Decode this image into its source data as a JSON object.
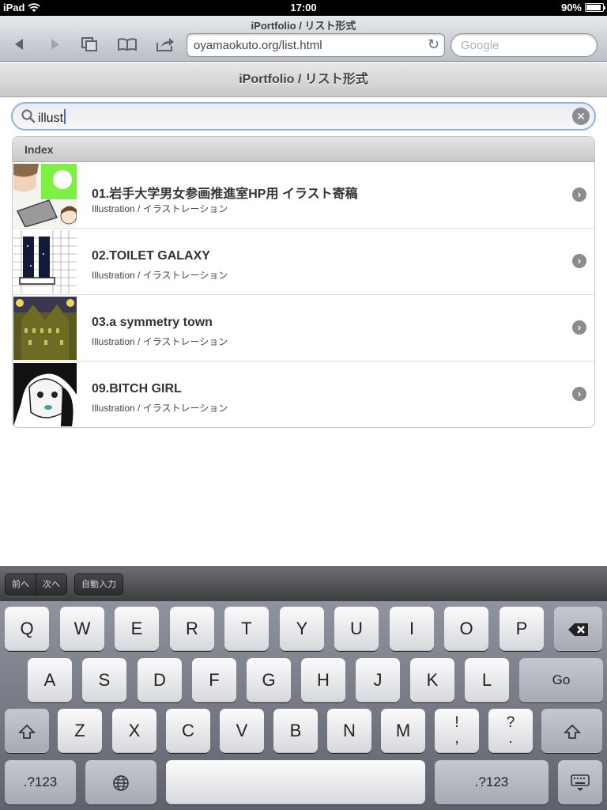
{
  "status": {
    "device": "iPad",
    "time": "17:00",
    "battery": "90%",
    "battery_level": 0.9
  },
  "browser": {
    "page_title": "iPortfolio / リスト形式",
    "url": "oyamaokuto.org/list.html",
    "search_placeholder": "Google"
  },
  "page": {
    "header": "iPortfolio / リスト形式",
    "search_value": "illust",
    "list_header": "Index",
    "items": [
      {
        "title": "01.岩手大学男女参画推進室HP用 イラスト寄稿",
        "subtitle": "Illustration / イラストレーション"
      },
      {
        "title": "02.TOILET GALAXY",
        "subtitle": "Illustration / イラストレーション"
      },
      {
        "title": "03.a symmetry town",
        "subtitle": "Illustration / イラストレーション"
      },
      {
        "title": "09.BITCH GIRL",
        "subtitle": "Illustration / イラストレーション"
      }
    ]
  },
  "accessory": {
    "prev": "前へ",
    "next": "次へ",
    "autofill": "自動入力"
  },
  "keyboard": {
    "row1": [
      "Q",
      "W",
      "E",
      "R",
      "T",
      "Y",
      "U",
      "I",
      "O",
      "P"
    ],
    "row2": [
      "A",
      "S",
      "D",
      "F",
      "G",
      "H",
      "J",
      "K",
      "L"
    ],
    "go": "Go",
    "row3": [
      "Z",
      "X",
      "C",
      "V",
      "B",
      "N",
      "M"
    ],
    "punct1": [
      "!",
      ","
    ],
    "punct2": [
      "?",
      "."
    ],
    "numbers": ".?123"
  }
}
